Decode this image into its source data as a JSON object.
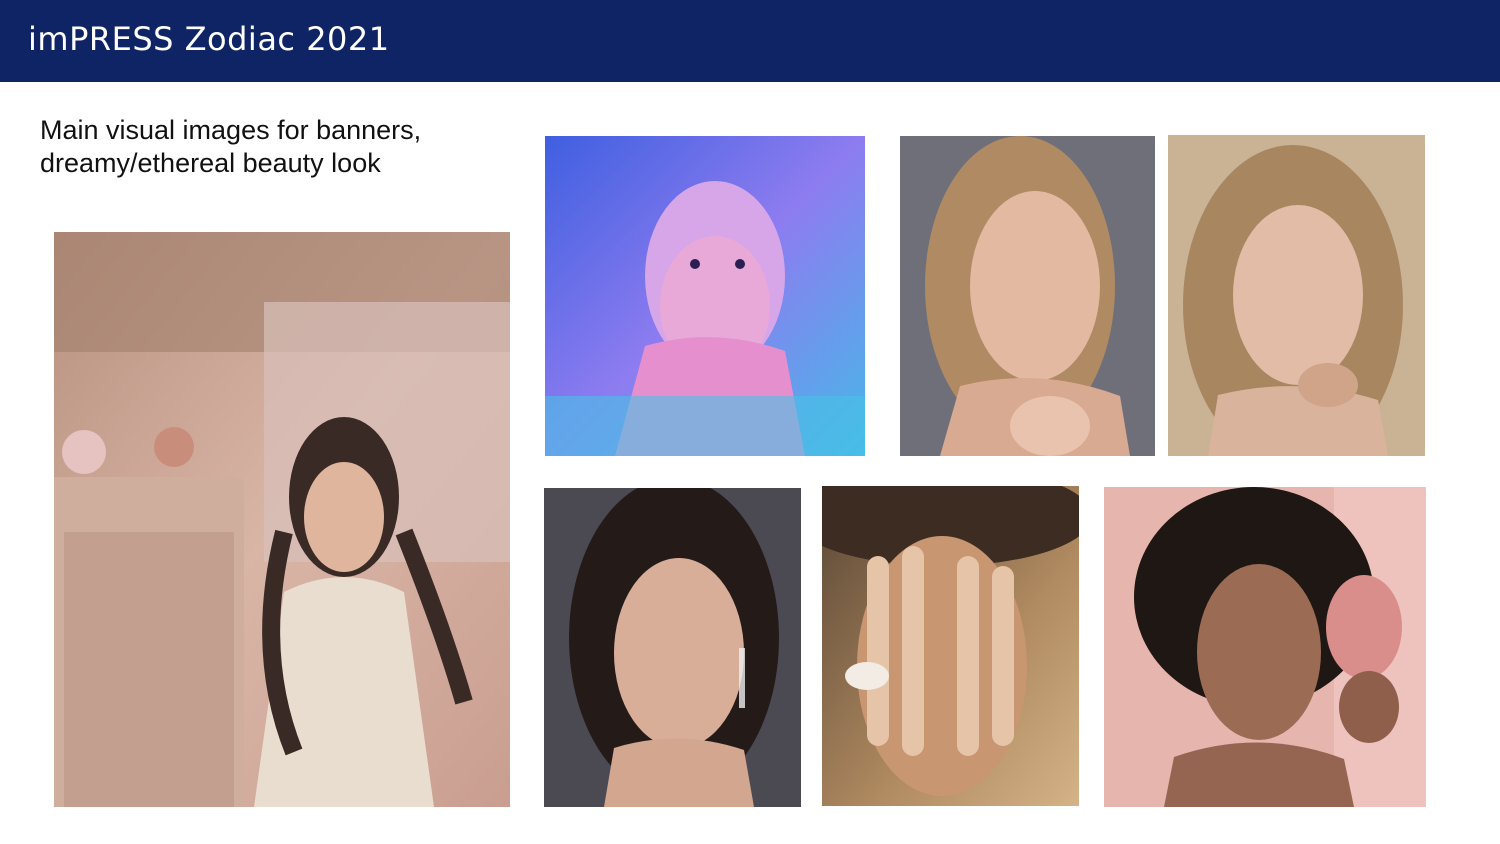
{
  "header": {
    "title": "imPRESS Zodiac 2021",
    "background_color": "#0f2464"
  },
  "caption": {
    "line1": "Main visual images for banners,",
    "line2": "dreamy/ethereal beauty look"
  },
  "photos": [
    {
      "icon": "portrait-photo",
      "tone": "rose-vintage"
    },
    {
      "icon": "portrait-photo",
      "tone": "blue-pink-neon"
    },
    {
      "icon": "portrait-photo",
      "tone": "warm-blonde-grey"
    },
    {
      "icon": "portrait-photo",
      "tone": "beige-blonde"
    },
    {
      "icon": "portrait-photo",
      "tone": "dark-grey-brunette"
    },
    {
      "icon": "portrait-photo",
      "tone": "golden-pearl-nails"
    },
    {
      "icon": "portrait-photo",
      "tone": "pink-curly-hair"
    }
  ]
}
